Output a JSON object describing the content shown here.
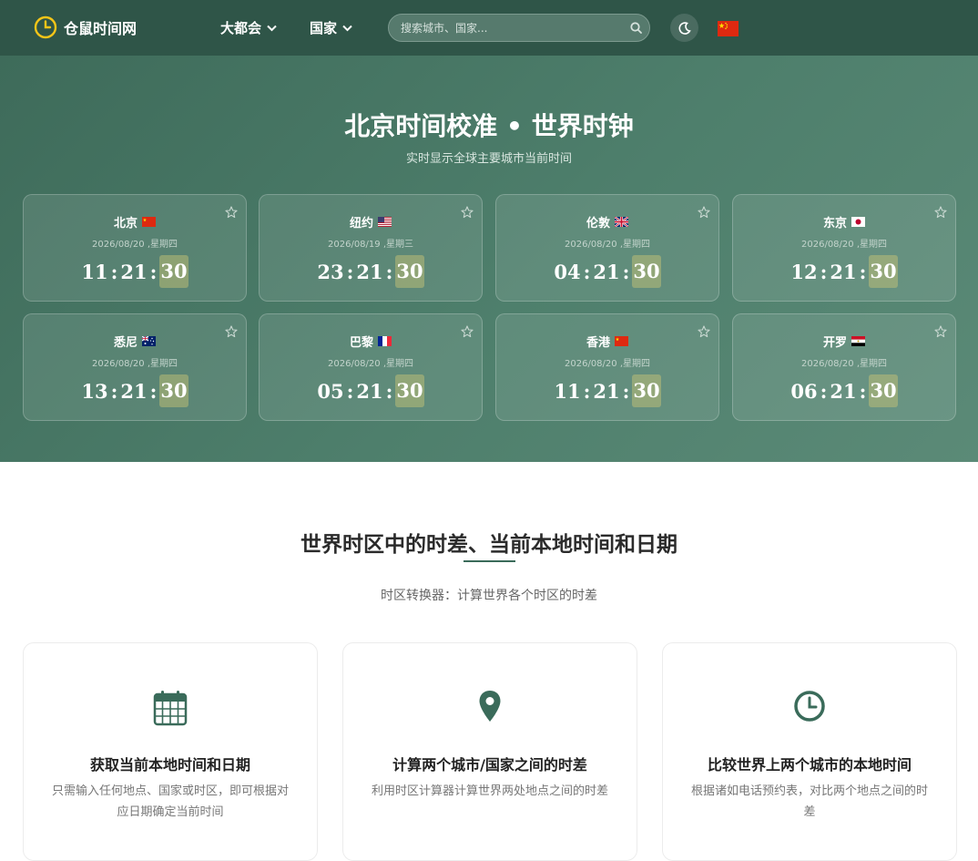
{
  "navbar": {
    "brand": "仓鼠时间网",
    "menu1": "大都会",
    "menu2": "国家",
    "search_placeholder": "搜索城市、国家...",
    "lang_flag": "cn"
  },
  "hero": {
    "title": "北京时间校准 • 世界时钟",
    "subtitle": "实时显示全球主要城市当前时间"
  },
  "clocks": [
    {
      "city": "北京",
      "flag": "cn",
      "date": "2026/08/20 ,星期四",
      "hh": "11",
      "mm": "21",
      "ss": "30"
    },
    {
      "city": "纽约",
      "flag": "us",
      "date": "2026/08/19 ,星期三",
      "hh": "23",
      "mm": "21",
      "ss": "30"
    },
    {
      "city": "伦敦",
      "flag": "gb",
      "date": "2026/08/20 ,星期四",
      "hh": "04",
      "mm": "21",
      "ss": "30"
    },
    {
      "city": "东京",
      "flag": "jp",
      "date": "2026/08/20 ,星期四",
      "hh": "12",
      "mm": "21",
      "ss": "30"
    },
    {
      "city": "悉尼",
      "flag": "au",
      "date": "2026/08/20 ,星期四",
      "hh": "13",
      "mm": "21",
      "ss": "30"
    },
    {
      "city": "巴黎",
      "flag": "fr",
      "date": "2026/08/20 ,星期四",
      "hh": "05",
      "mm": "21",
      "ss": "30"
    },
    {
      "city": "香港",
      "flag": "cn",
      "date": "2026/08/20 ,星期四",
      "hh": "11",
      "mm": "21",
      "ss": "30"
    },
    {
      "city": "开罗",
      "flag": "eg",
      "date": "2026/08/20 ,星期四",
      "hh": "06",
      "mm": "21",
      "ss": "30"
    }
  ],
  "section": {
    "title": "世界时区中的时差、当前本地时间和日期",
    "subtitle": "时区转换器：计算世界各个时区的时差"
  },
  "features": [
    {
      "icon": "calendar-icon",
      "title": "获取当前本地时间和日期",
      "desc": "只需输入任何地点、国家或时区，即可根据对应日期确定当前时间"
    },
    {
      "icon": "map-pin-icon",
      "title": "计算两个城市/国家之间的时差",
      "desc": "利用时区计算器计算世界两处地点之间的时差"
    },
    {
      "icon": "clock-icon",
      "title": "比较世界上两个城市的本地时间",
      "desc": "根据诸如电话预约表，对比两个地点之间的时差"
    }
  ],
  "colors": {
    "nav_bg": "#2f5548",
    "hero_bg": "#4e7f6c",
    "accent": "#3a6b5a",
    "brand_icon": "#f5c518"
  }
}
